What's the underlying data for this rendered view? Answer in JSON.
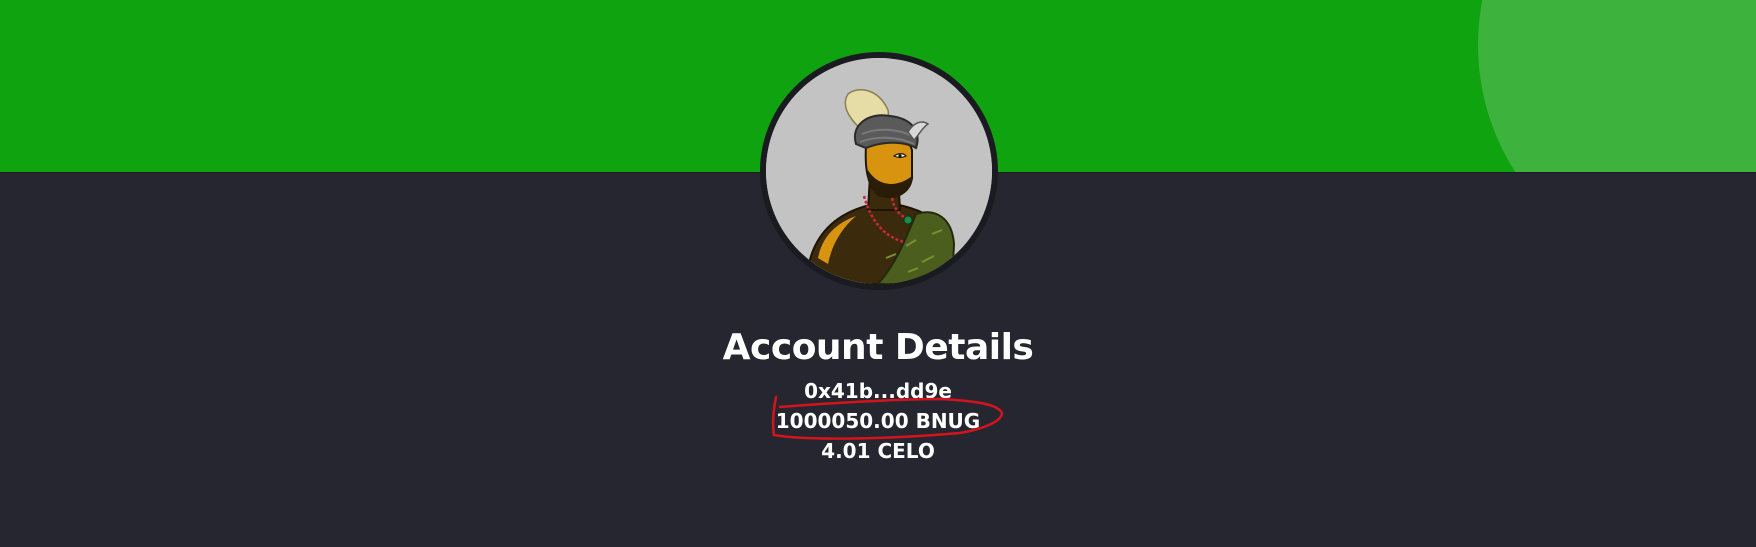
{
  "account": {
    "title": "Account Details",
    "address": "0x41b...dd9e",
    "bnug_balance": "1000050.00 BNUG",
    "celo_balance": "4.01 CELO"
  },
  "colors": {
    "banner": "#0fa30f",
    "banner_accent": "#3db33d",
    "background": "#25262f",
    "annotation": "#d4141c"
  },
  "icons": {
    "avatar": "profile-avatar-illustration",
    "annotation": "hand-drawn-circle-annotation"
  }
}
